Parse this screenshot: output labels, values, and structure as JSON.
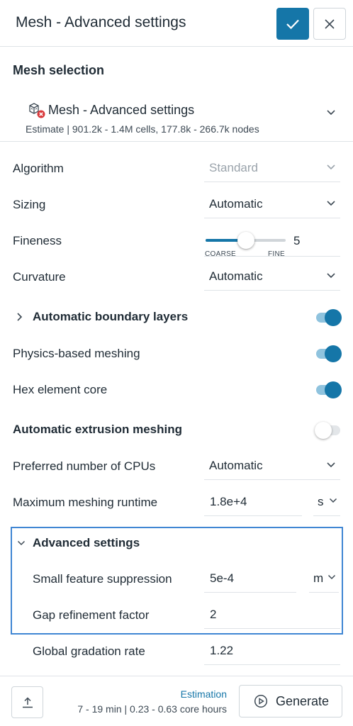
{
  "header": {
    "title": "Mesh - Advanced settings"
  },
  "mesh_selection": {
    "heading": "Mesh selection",
    "name": "Mesh - Advanced settings",
    "estimate": "Estimate | 901.2k - 1.4M cells, 177.8k - 266.7k nodes"
  },
  "algorithm": {
    "label": "Algorithm",
    "value": "Standard",
    "disabled": true
  },
  "sizing": {
    "label": "Sizing",
    "value": "Automatic"
  },
  "fineness": {
    "label": "Fineness",
    "value": "5",
    "level_fraction": 0.5,
    "min_label": "COARSE",
    "max_label": "FINE"
  },
  "curvature": {
    "label": "Curvature",
    "value": "Automatic"
  },
  "boundary_layers": {
    "label": "Automatic boundary layers",
    "enabled": true
  },
  "physics_meshing": {
    "label": "Physics-based meshing",
    "enabled": true
  },
  "hex_core": {
    "label": "Hex element core",
    "enabled": true
  },
  "extrusion": {
    "label": "Automatic extrusion meshing",
    "enabled": false
  },
  "cpus": {
    "label": "Preferred number of CPUs",
    "value": "Automatic"
  },
  "runtime": {
    "label": "Maximum meshing runtime",
    "value": "1.8e+4",
    "unit": "s"
  },
  "advanced": {
    "heading": "Advanced settings",
    "small_feature": {
      "label": "Small feature suppression",
      "value": "5e-4",
      "unit": "m"
    },
    "gap_refinement": {
      "label": "Gap refinement factor",
      "value": "2"
    },
    "gradation": {
      "label": "Global gradation rate",
      "value": "1.22"
    }
  },
  "footer": {
    "estimation_title": "Estimation",
    "estimation_text": "7 - 19 min | 0.23 - 0.63 core hours",
    "generate_label": "Generate"
  },
  "colors": {
    "accent": "#1576a8",
    "focus_border": "#3f86d3",
    "error": "#d9383a"
  }
}
